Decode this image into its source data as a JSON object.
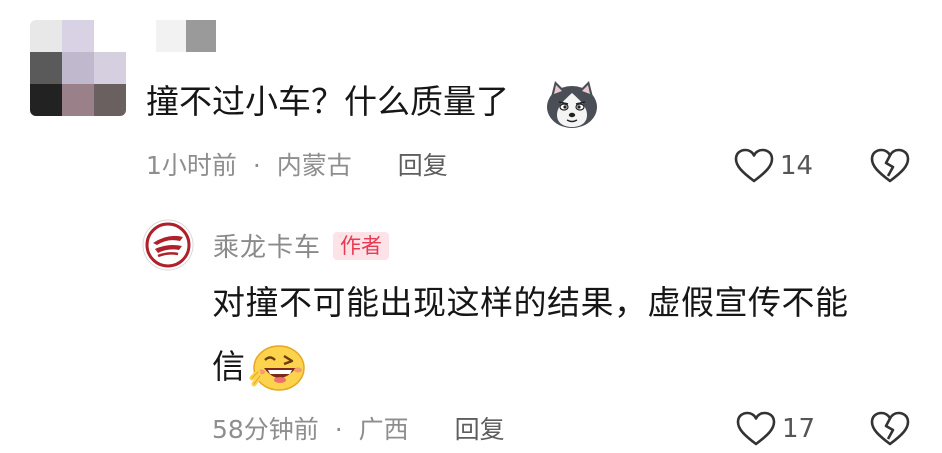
{
  "comment": {
    "text": "撞不过小车？什么质量了",
    "emoji": "husky-emoji",
    "time": "1小时前",
    "separator": "·",
    "location": "内蒙古",
    "reply_label": "回复",
    "likes": "14",
    "avatar_colors": [
      "#e8e8e8",
      "#d8d2e4",
      "#ffffff",
      "#5a5a5a",
      "#c0b8cc",
      "#d6cfe0",
      "#222222",
      "#9a8088",
      "#6a6060"
    ],
    "name_colors": [
      "#f2f2f2",
      "#9a9a9a"
    ]
  },
  "reply": {
    "author": "乘龙卡车",
    "badge": "作者",
    "text_line1": "对撞不可能出现这样的结果，虚假宣传不能",
    "text_line2": "信",
    "emoji": "laughing-wink-emoji",
    "time": "58分钟前",
    "separator": "·",
    "location": "广西",
    "reply_label": "回复",
    "likes": "17",
    "brand_color": "#b0202a"
  },
  "colors": {
    "text": "#161616",
    "meta": "#8e8e8e",
    "badge_bg": "#fde3e7",
    "badge_text": "#e73a53"
  }
}
